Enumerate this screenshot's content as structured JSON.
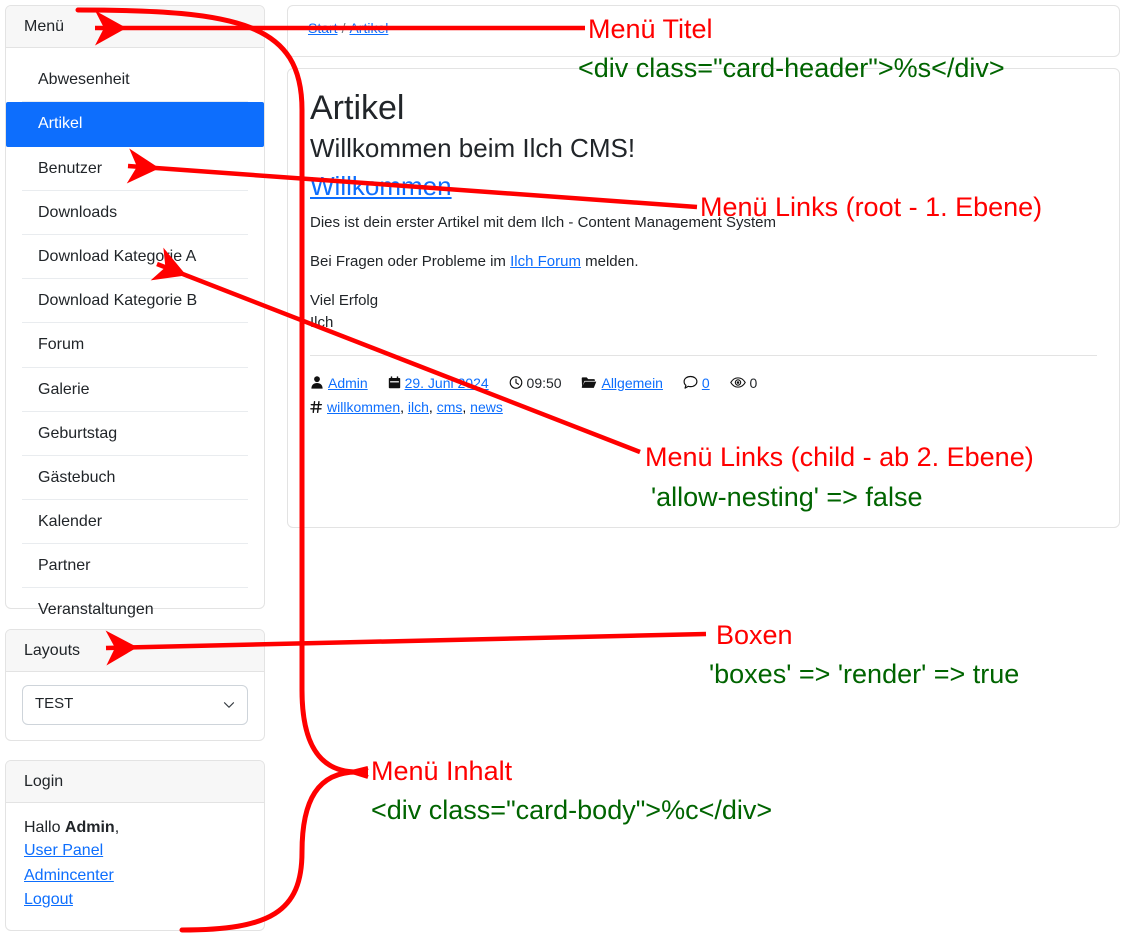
{
  "sidebar": {
    "menu": {
      "title": "Menü",
      "items": [
        {
          "label": "Abwesenheit",
          "active": false
        },
        {
          "label": "Artikel",
          "active": true
        },
        {
          "label": "Benutzer",
          "active": false
        },
        {
          "label": "Downloads",
          "active": false
        },
        {
          "label": "Download Kategorie A",
          "active": false
        },
        {
          "label": "Download Kategorie B",
          "active": false
        },
        {
          "label": "Forum",
          "active": false
        },
        {
          "label": "Galerie",
          "active": false
        },
        {
          "label": "Geburtstag",
          "active": false
        },
        {
          "label": "Gästebuch",
          "active": false
        },
        {
          "label": "Kalender",
          "active": false
        },
        {
          "label": "Partner",
          "active": false
        },
        {
          "label": "Veranstaltungen",
          "active": false
        }
      ]
    },
    "layouts": {
      "title": "Layouts",
      "selected": "TEST",
      "options": [
        "TEST"
      ]
    },
    "login": {
      "title": "Login",
      "greeting_prefix": "Hallo ",
      "username": "Admin",
      "greeting_suffix": ",",
      "links": [
        "User Panel",
        "Admincenter",
        "Logout"
      ]
    }
  },
  "breadcrumb": {
    "items": [
      "Start",
      "Artikel"
    ],
    "separator": "/"
  },
  "article": {
    "page_title": "Artikel",
    "subtitle": "Willkommen beim Ilch CMS!",
    "title_link": "Willkommen",
    "paragraph1": "Dies ist dein erster Artikel mit dem Ilch - Content Management System",
    "paragraph2_pre": "Bei Fragen oder Probleme im ",
    "paragraph2_link": "Ilch Forum",
    "paragraph2_post": " melden.",
    "signoff_line1": "Viel Erfolg",
    "signoff_line2": "Ilch",
    "meta": {
      "author": "Admin",
      "date": "29. Juni 2024",
      "time": "09:50",
      "category": "Allgemein",
      "comments": "0",
      "views": "0",
      "tags": [
        "willkommen",
        "ilch",
        "cms",
        "news"
      ],
      "tag_separator": ", "
    }
  },
  "annotations": [
    {
      "id": "menu-titel",
      "red": "Menü Titel",
      "green": "<div class=\"card-header\">%s</div>"
    },
    {
      "id": "menu-links-root",
      "red": "Menü Links (root - 1. Ebene)",
      "green": ""
    },
    {
      "id": "menu-links-child",
      "red": "Menü Links (child - ab 2. Ebene)",
      "green": "'allow-nesting' => false"
    },
    {
      "id": "boxen",
      "red": "Boxen",
      "green": "'boxes' => 'render' => true"
    },
    {
      "id": "menu-inhalt",
      "red": "Menü Inhalt",
      "green": "<div class=\"card-body\">%c</div>"
    }
  ],
  "colors": {
    "accent": "#0d6efd",
    "annotation_red": "#ff0000",
    "annotation_green": "#006400",
    "card_border": "#e3e3e3",
    "card_header_bg": "#f7f7f7"
  }
}
